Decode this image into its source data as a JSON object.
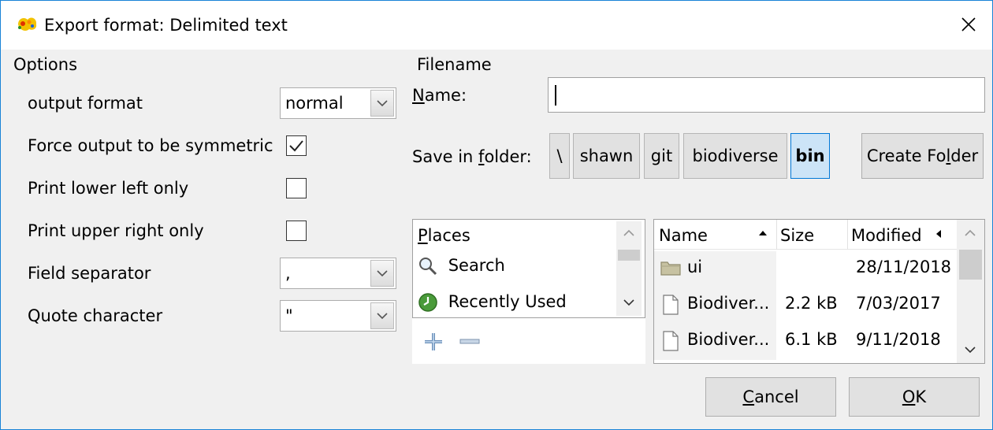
{
  "window": {
    "title": "Export format: Delimited text"
  },
  "options": {
    "section_label": "Options",
    "output_format": {
      "label": "output format",
      "value": "normal"
    },
    "force_symmetric": {
      "label": "Force output to be symmetric",
      "checked": true
    },
    "lower_left": {
      "label": "Print lower left only",
      "checked": false
    },
    "upper_right": {
      "label": "Print upper right only",
      "checked": false
    },
    "field_separator": {
      "label": "Field separator",
      "value": ","
    },
    "quote_character": {
      "label": "Quote character",
      "value": "\""
    }
  },
  "filename": {
    "section_label": "Filename",
    "name_label_pre": "",
    "name_label_mnemonic": "N",
    "name_label_post": "ame:",
    "name_value": "",
    "save_in_label_pre": "Save in ",
    "save_in_label_mnemonic": "f",
    "save_in_label_post": "older:",
    "path": [
      "\\",
      "shawn",
      "git",
      "biodiverse",
      "bin"
    ],
    "create_folder_pre": "Create Fo",
    "create_folder_mnemonic": "l",
    "create_folder_post": "der"
  },
  "places": {
    "header": "Places",
    "items": [
      {
        "label": "Search",
        "icon": "search-icon"
      },
      {
        "label": "Recently Used",
        "icon": "recent-icon"
      }
    ]
  },
  "files": {
    "columns": {
      "name": "Name",
      "size": "Size",
      "modified": "Modified"
    },
    "rows": [
      {
        "name": "ui",
        "size": "",
        "modified": "28/11/2018",
        "icon": "folder-icon"
      },
      {
        "name": "Biodiver...",
        "size": "2.2 kB",
        "modified": "7/03/2017",
        "icon": "file-icon"
      },
      {
        "name": "Biodiver...",
        "size": "6.1 kB",
        "modified": "9/11/2018",
        "icon": "file-icon"
      }
    ]
  },
  "buttons": {
    "cancel_mnemonic": "C",
    "cancel_post": "ancel",
    "ok_mnemonic": "O",
    "ok_post": "K"
  }
}
